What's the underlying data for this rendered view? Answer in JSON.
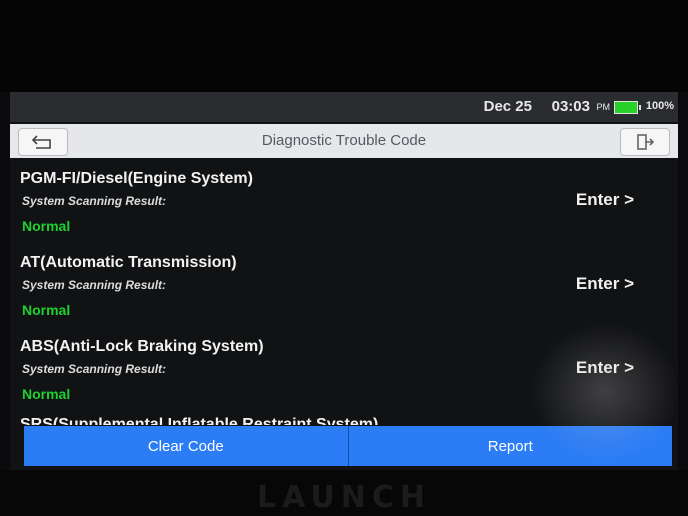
{
  "statusbar": {
    "date": "Dec 25",
    "time": "03:03",
    "ampm": "PM",
    "battery": "100%"
  },
  "titlebar": {
    "title": "Diagnostic Trouble Code"
  },
  "systems": [
    {
      "name": "PGM-FI/Diesel(Engine System)",
      "result_label": "System Scanning Result:",
      "status": "Normal",
      "action": "Enter >"
    },
    {
      "name": "AT(Automatic Transmission)",
      "result_label": "System Scanning Result:",
      "status": "Normal",
      "action": "Enter >"
    },
    {
      "name": "ABS(Anti-Lock Braking System)",
      "result_label": "System Scanning Result:",
      "status": "Normal",
      "action": "Enter >"
    },
    {
      "name": "SRS(Supplemental Inflatable Restraint System)"
    }
  ],
  "buttons": {
    "clear_code": "Clear Code",
    "report": "Report"
  },
  "brand": "LAUNCH",
  "colors": {
    "accent": "#2b7cf5",
    "status_ok": "#1fd12f",
    "titlebar_bg": "#e6e7ea"
  },
  "icons": {
    "back": "back-arrow-icon",
    "exit": "exit-door-icon",
    "battery": "battery-icon"
  }
}
